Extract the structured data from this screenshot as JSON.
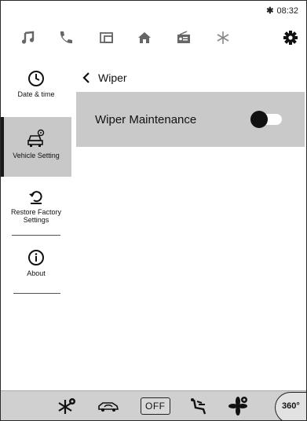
{
  "status_bar": {
    "bluetooth_icon": "bluetooth-icon",
    "time": "08:32"
  },
  "top_nav": [
    {
      "name": "music",
      "icon": "music-note-icon"
    },
    {
      "name": "phone",
      "icon": "phone-icon"
    },
    {
      "name": "apps",
      "icon": "folder-icon"
    },
    {
      "name": "home",
      "icon": "home-icon"
    },
    {
      "name": "radio",
      "icon": "radio-icon"
    },
    {
      "name": "climate",
      "icon": "snowflake-icon"
    },
    {
      "name": "settings",
      "icon": "gear-icon",
      "active": true
    }
  ],
  "sidebar": {
    "items": [
      {
        "label": "Date & time",
        "icon": "clock-icon"
      },
      {
        "label": "Vehicle Setting",
        "icon": "car-settings-icon",
        "active": true
      },
      {
        "label": "Restore Factory Settings",
        "icon": "restore-icon"
      },
      {
        "label": "About",
        "icon": "info-icon"
      }
    ]
  },
  "page": {
    "back_icon": "chevron-left-icon",
    "title": "Wiper"
  },
  "settings": [
    {
      "label": "Wiper Maintenance",
      "type": "toggle",
      "value": "off"
    }
  ],
  "bottom_bar": {
    "items": [
      {
        "name": "defrost",
        "icon": "snowflake-fan-icon"
      },
      {
        "name": "recirculation",
        "icon": "car-recirculation-icon"
      },
      {
        "name": "climate-off",
        "label": "OFF"
      },
      {
        "name": "air-direction",
        "icon": "seat-airflow-icon"
      },
      {
        "name": "fan",
        "icon": "fan-icon"
      },
      {
        "name": "camera-360",
        "label": "360°"
      }
    ]
  },
  "colors": {
    "sidebar_active": "#c8c8c8",
    "card_bg": "#c9c9c9",
    "bottom_bar_bg": "#d0d0d0",
    "toggle_knob": "#111111"
  }
}
